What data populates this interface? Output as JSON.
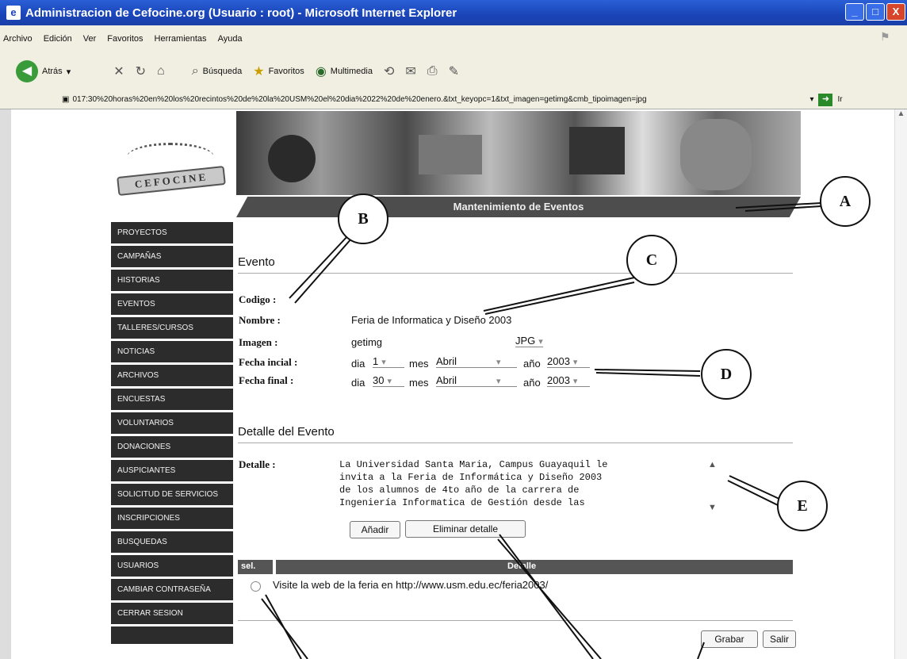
{
  "window": {
    "title": "Administracion de Cefocine.org (Usuario : root) - Microsoft Internet Explorer",
    "buttons": [
      "_",
      "□",
      "X"
    ]
  },
  "menu": [
    "Archivo",
    "Edición",
    "Ver",
    "Favoritos",
    "Herramientas",
    "Ayuda"
  ],
  "toolbar": {
    "back": "Atrás",
    "search": "Búsqueda",
    "favorites": "Favoritos",
    "multimedia": "Multimedia"
  },
  "address": {
    "url": "017:30%20horas%20en%20los%20recintos%20de%20la%20USM%20el%20dia%2022%20de%20enero.&txt_keyopc=1&txt_imagen=getimg&cmb_tipoimagen=jpg",
    "go": "Ir"
  },
  "logo": {
    "text": "CEFOCINE"
  },
  "header": {
    "title": "Mantenimiento de Eventos"
  },
  "sidebar": {
    "items": [
      "PROYECTOS",
      "CAMPAÑAS",
      "HISTORIAS",
      "EVENTOS",
      "TALLERES/CURSOS",
      "NOTICIAS",
      "ARCHIVOS",
      "ENCUESTAS",
      "VOLUNTARIOS",
      "DONACIONES",
      "AUSPICIANTES",
      "SOLICITUD DE SERVICIOS",
      "INSCRIPCIONES",
      "BUSQUEDAS",
      "USUARIOS",
      "CAMBIAR CONTRASEÑA",
      "CERRAR SESION"
    ]
  },
  "evento": {
    "section_title": "Evento",
    "codigo_label": "Codigo :",
    "nombre_label": "Nombre :",
    "nombre_value": "Feria de Informatica y Diseño 2003",
    "imagen_label": "Imagen :",
    "imagen_value": "getimg",
    "imagen_type": "JPG",
    "fecha_inicial_label": "Fecha incial :",
    "fecha_final_label": "Fecha final :",
    "dia_label": "dia",
    "mes_label": "mes",
    "anio_label": "año",
    "inicio": {
      "dia": "1",
      "mes": "Abril",
      "anio": "2003"
    },
    "fin": {
      "dia": "30",
      "mes": "Abril",
      "anio": "2003"
    }
  },
  "detalle": {
    "section_title": "Detalle del Evento",
    "detalle_label": "Detalle :",
    "text": "La Universidad Santa Maria, Campus Guayaquil le\ninvita a la Feria de Informática y Diseño 2003\nde los alumnos de 4to año de la carrera de\nIngeniería Informatica de Gestión desde las",
    "add_button": "Añadir",
    "delete_button": "Eliminar detalle",
    "table_headers": [
      "sel.",
      "Detalle"
    ],
    "rows": [
      "Visite la web de la feria en http://www.usm.edu.ec/feria2003/"
    ]
  },
  "actions": {
    "save": "Grabar",
    "exit": "Salir"
  },
  "callouts": [
    "A",
    "B",
    "C",
    "D",
    "E"
  ]
}
